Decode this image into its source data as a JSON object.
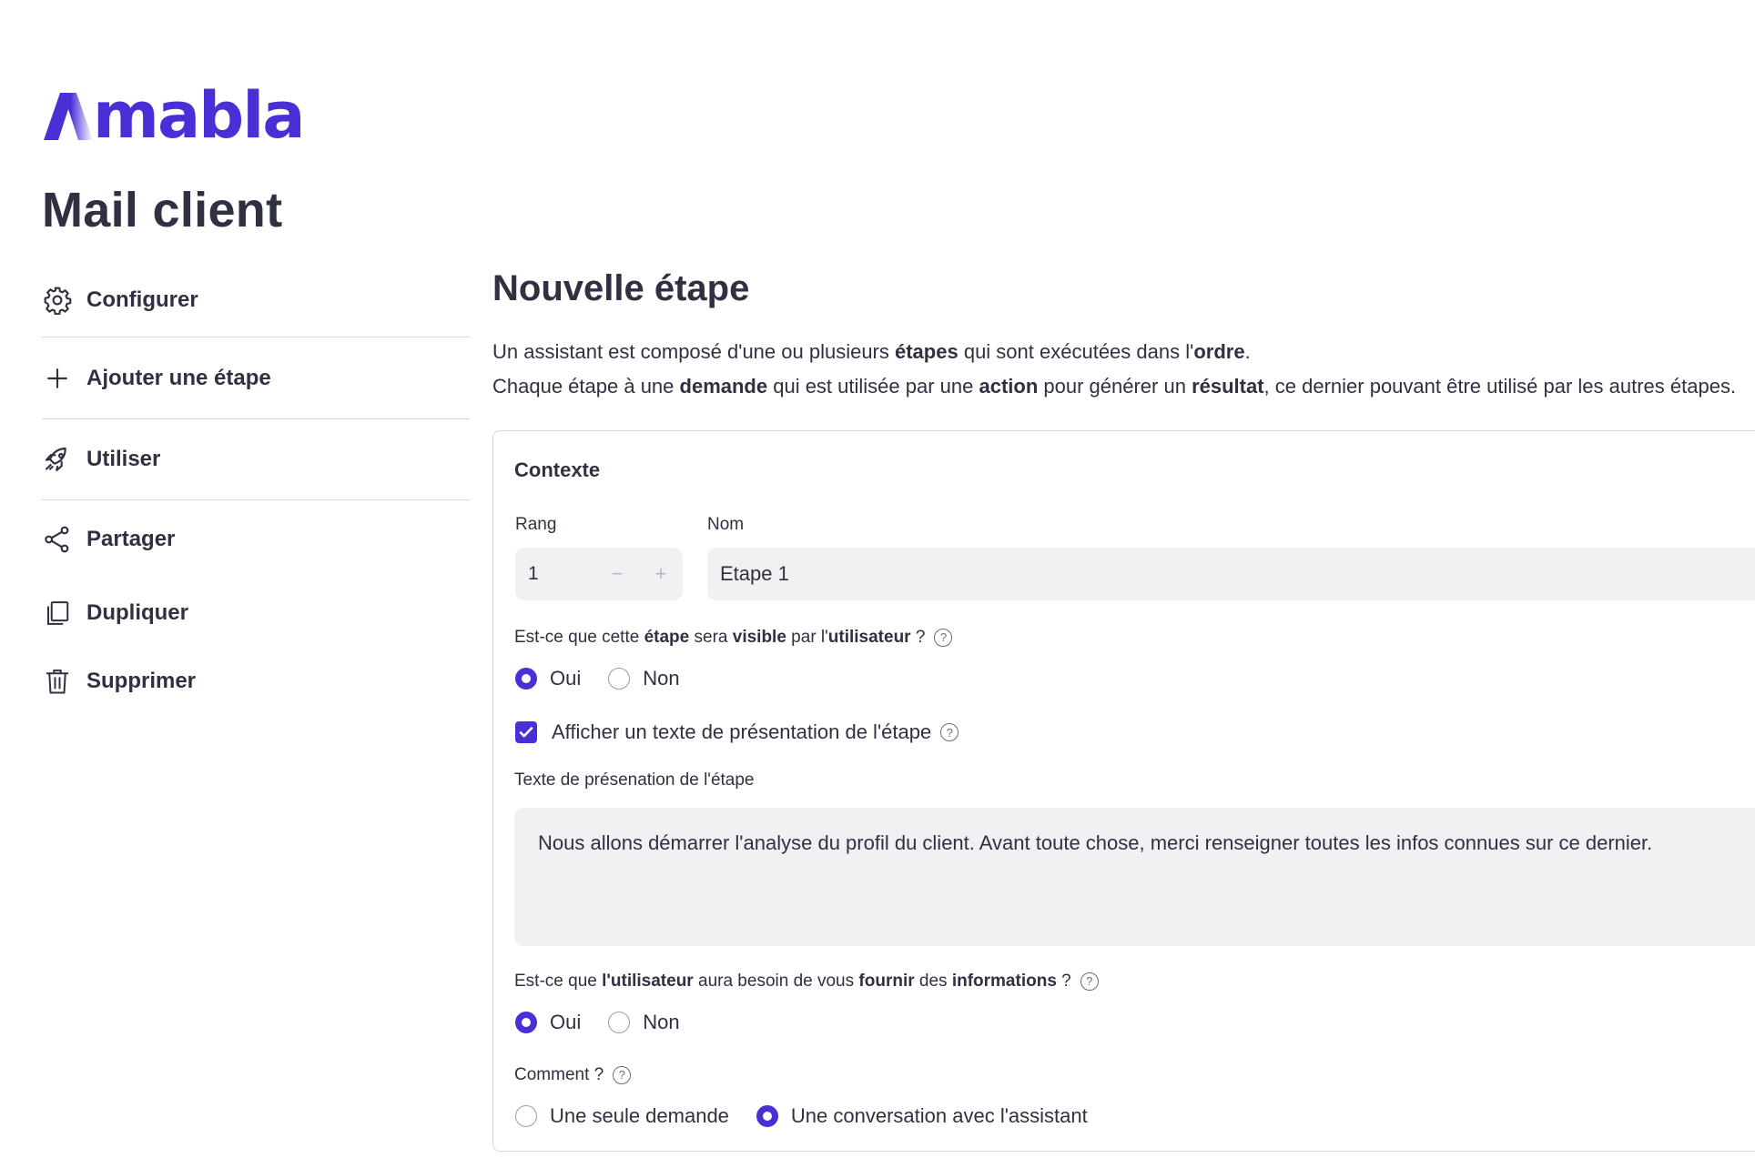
{
  "brand": {
    "name": "mabla",
    "color": "#4b2fd6"
  },
  "app": {
    "title": "Mail client"
  },
  "sidebar": {
    "items": [
      {
        "label": "Configurer",
        "icon": "gear-icon"
      },
      {
        "label": "Ajouter une étape",
        "icon": "plus-icon"
      },
      {
        "label": "Utiliser",
        "icon": "rocket-icon"
      },
      {
        "label": "Partager",
        "icon": "share-icon"
      },
      {
        "label": "Dupliquer",
        "icon": "duplicate-icon"
      },
      {
        "label": "Supprimer",
        "icon": "trash-icon"
      }
    ]
  },
  "main": {
    "title": "Nouvelle étape",
    "intro1": {
      "t1": "Un assistant est composé d'une ou plusieurs ",
      "b1": "étapes",
      "t2": " qui sont exécutées dans l'",
      "b2": "ordre",
      "t3": "."
    },
    "intro2": {
      "t1": "Chaque étape à une ",
      "b1": "demande",
      "t2": " qui est utilisée par une ",
      "b2": "action",
      "t3": " pour générer un ",
      "b3": "résultat",
      "t4": ", ce dernier pouvant être utilisé par les autres étapes."
    }
  },
  "card": {
    "title": "Contexte",
    "rank": {
      "label": "Rang",
      "value": "1",
      "minus": "−",
      "plus": "+"
    },
    "name": {
      "label": "Nom",
      "value": "Etape 1"
    },
    "visible_q": {
      "t1": "Est-ce que cette ",
      "b1": "étape",
      "t2": " sera ",
      "b2": "visible",
      "t3": " par l'",
      "b3": "utilisateur",
      "t4": " ?"
    },
    "visible_options": {
      "yes": "Oui",
      "no": "Non",
      "selected": "Oui"
    },
    "show_text": {
      "label": "Afficher un texte de présentation de l'étape",
      "checked": true
    },
    "presentation": {
      "label": "Texte de présenation de l'étape",
      "value": "Nous allons démarrer l'analyse du profil du client. Avant toute chose, merci renseigner toutes les infos connues sur ce dernier."
    },
    "info_q": {
      "t1": "Est-ce que ",
      "b1": "l'utilisateur",
      "t2": " aura besoin de vous ",
      "b2": "fournir",
      "t3": " des ",
      "b3": "informations",
      "t4": " ?"
    },
    "info_options": {
      "yes": "Oui",
      "no": "Non",
      "selected": "Oui"
    },
    "how": {
      "label": "Comment ?",
      "single": "Une seule demande",
      "conversation": "Une conversation avec l'assistant",
      "selected": "Une conversation avec l'assistant"
    },
    "help_glyph": "?"
  }
}
